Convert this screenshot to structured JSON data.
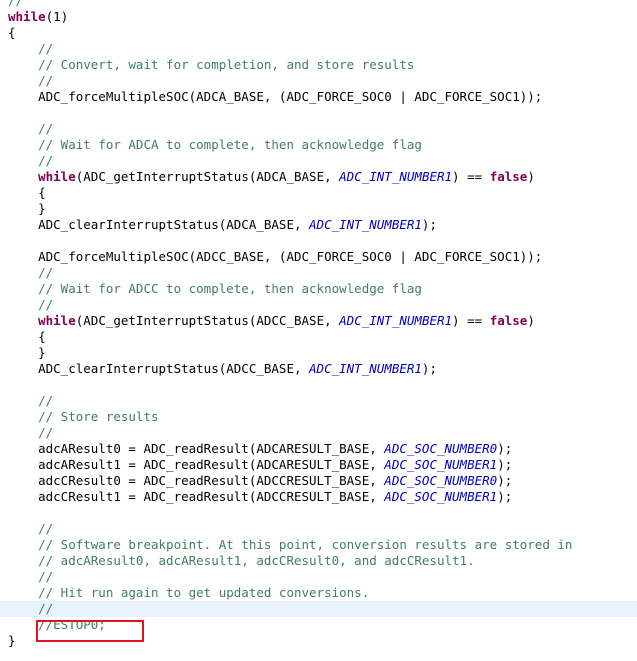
{
  "editor": {
    "highlight_line_index": 38,
    "lines": [
      [
        {
          "t": "//",
          "c": "comment"
        }
      ],
      [
        {
          "t": "while",
          "c": "keyword"
        },
        {
          "t": "(1)",
          "c": "plain"
        }
      ],
      [
        {
          "t": "{",
          "c": "plain"
        }
      ],
      [
        {
          "t": "    //",
          "c": "comment"
        }
      ],
      [
        {
          "t": "    // Convert, wait for completion, and store results",
          "c": "comment"
        }
      ],
      [
        {
          "t": "    //",
          "c": "comment"
        }
      ],
      [
        {
          "t": "    ADC_forceMultipleSOC(ADCA_BASE, (ADC_FORCE_SOC0 | ADC_FORCE_SOC1));",
          "c": "plain"
        }
      ],
      [
        {
          "t": "",
          "c": "plain"
        }
      ],
      [
        {
          "t": "    //",
          "c": "comment"
        }
      ],
      [
        {
          "t": "    // Wait for ADCA to complete, then acknowledge flag",
          "c": "comment"
        }
      ],
      [
        {
          "t": "    //",
          "c": "comment"
        }
      ],
      [
        {
          "t": "    ",
          "c": "plain"
        },
        {
          "t": "while",
          "c": "keyword"
        },
        {
          "t": "(ADC_getInterruptStatus(ADCA_BASE, ",
          "c": "plain"
        },
        {
          "t": "ADC_INT_NUMBER1",
          "c": "enum"
        },
        {
          "t": ") == ",
          "c": "plain"
        },
        {
          "t": "false",
          "c": "keyword"
        },
        {
          "t": ")",
          "c": "plain"
        }
      ],
      [
        {
          "t": "    {",
          "c": "plain"
        }
      ],
      [
        {
          "t": "    }",
          "c": "plain"
        }
      ],
      [
        {
          "t": "    ADC_clearInterruptStatus(ADCA_BASE, ",
          "c": "plain"
        },
        {
          "t": "ADC_INT_NUMBER1",
          "c": "enum"
        },
        {
          "t": ");",
          "c": "plain"
        }
      ],
      [
        {
          "t": "",
          "c": "plain"
        }
      ],
      [
        {
          "t": "    ADC_forceMultipleSOC(ADCC_BASE, (ADC_FORCE_SOC0 | ADC_FORCE_SOC1));",
          "c": "plain"
        }
      ],
      [
        {
          "t": "    //",
          "c": "comment"
        }
      ],
      [
        {
          "t": "    // Wait for ADCC to complete, then acknowledge flag",
          "c": "comment"
        }
      ],
      [
        {
          "t": "    //",
          "c": "comment"
        }
      ],
      [
        {
          "t": "    ",
          "c": "plain"
        },
        {
          "t": "while",
          "c": "keyword"
        },
        {
          "t": "(ADC_getInterruptStatus(ADCC_BASE, ",
          "c": "plain"
        },
        {
          "t": "ADC_INT_NUMBER1",
          "c": "enum"
        },
        {
          "t": ") == ",
          "c": "plain"
        },
        {
          "t": "false",
          "c": "keyword"
        },
        {
          "t": ")",
          "c": "plain"
        }
      ],
      [
        {
          "t": "    {",
          "c": "plain"
        }
      ],
      [
        {
          "t": "    }",
          "c": "plain"
        }
      ],
      [
        {
          "t": "    ADC_clearInterruptStatus(ADCC_BASE, ",
          "c": "plain"
        },
        {
          "t": "ADC_INT_NUMBER1",
          "c": "enum"
        },
        {
          "t": ");",
          "c": "plain"
        }
      ],
      [
        {
          "t": "",
          "c": "plain"
        }
      ],
      [
        {
          "t": "    //",
          "c": "comment"
        }
      ],
      [
        {
          "t": "    // Store results",
          "c": "comment"
        }
      ],
      [
        {
          "t": "    //",
          "c": "comment"
        }
      ],
      [
        {
          "t": "    adcAResult0 = ADC_readResult(ADCARESULT_BASE, ",
          "c": "plain"
        },
        {
          "t": "ADC_SOC_NUMBER0",
          "c": "enum"
        },
        {
          "t": ");",
          "c": "plain"
        }
      ],
      [
        {
          "t": "    adcAResult1 = ADC_readResult(ADCARESULT_BASE, ",
          "c": "plain"
        },
        {
          "t": "ADC_SOC_NUMBER1",
          "c": "enum"
        },
        {
          "t": ");",
          "c": "plain"
        }
      ],
      [
        {
          "t": "    adcCResult0 = ADC_readResult(ADCCRESULT_BASE, ",
          "c": "plain"
        },
        {
          "t": "ADC_SOC_NUMBER0",
          "c": "enum"
        },
        {
          "t": ");",
          "c": "plain"
        }
      ],
      [
        {
          "t": "    adcCResult1 = ADC_readResult(ADCCRESULT_BASE, ",
          "c": "plain"
        },
        {
          "t": "ADC_SOC_NUMBER1",
          "c": "enum"
        },
        {
          "t": ");",
          "c": "plain"
        }
      ],
      [
        {
          "t": "",
          "c": "plain"
        }
      ],
      [
        {
          "t": "    //",
          "c": "comment"
        }
      ],
      [
        {
          "t": "    // Software breakpoint. At this point, conversion results are stored in",
          "c": "comment"
        }
      ],
      [
        {
          "t": "    // adcAResult0, adcAResult1, adcCResult0, and adcCResult1.",
          "c": "comment"
        }
      ],
      [
        {
          "t": "    //",
          "c": "comment"
        }
      ],
      [
        {
          "t": "    // Hit run again to get updated conversions.",
          "c": "comment"
        }
      ],
      [
        {
          "t": "    //",
          "c": "comment"
        }
      ],
      [
        {
          "t": "    //ESTOP0;",
          "c": "comment"
        }
      ],
      [
        {
          "t": "}",
          "c": "plain"
        }
      ]
    ]
  },
  "colors": {
    "comment": "#3f7f5f",
    "keyword": "#7f0055",
    "enum": "#0000c0",
    "highlight": "#e8f2fe",
    "annotation": "#e0141e"
  }
}
